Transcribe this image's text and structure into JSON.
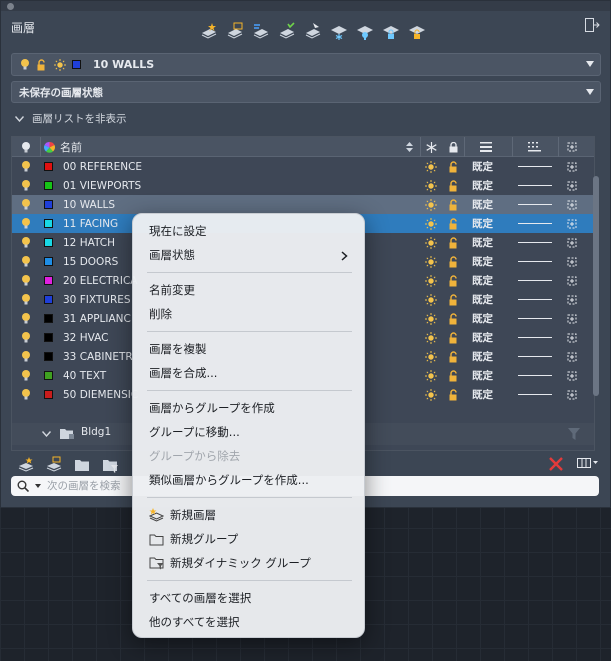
{
  "panel": {
    "title": "画層",
    "current_layer": {
      "name": "10 WALLS",
      "color": "#1f3fd8"
    },
    "layer_state": "未保存の画層状態",
    "collapse_label": "画層リストを非表示",
    "search_placeholder": "次の画層を検索"
  },
  "toolbar_icons": [
    "new-layer-icon",
    "new-vp-frozen-layer-icon",
    "delete-layer-icon",
    "set-current-icon",
    "layer-match-icon",
    "freeze-icon",
    "isolate-icon",
    "lock-icon",
    "unlock-icon"
  ],
  "table": {
    "headers": {
      "name": "名前"
    },
    "rows": [
      {
        "name": "00 REFERENCE",
        "color": "#e01010",
        "linetype": "既定"
      },
      {
        "name": "01 VIEWPORTS",
        "color": "#16c316",
        "linetype": "既定"
      },
      {
        "name": "10 WALLS",
        "color": "#1f3fd8",
        "linetype": "既定",
        "state": "current"
      },
      {
        "name": "11 FACING",
        "color": "#19d8e6",
        "linetype": "既定",
        "state": "selected"
      },
      {
        "name": "12 HATCH",
        "color": "#19d8e6",
        "linetype": "既定"
      },
      {
        "name": "15 DOORS",
        "color": "#1f8ee6",
        "linetype": "既定"
      },
      {
        "name": "20 ELECTRICA",
        "color": "#e020e0",
        "linetype": "既定"
      },
      {
        "name": "30 FIXTURES",
        "color": "#1f3fd8",
        "linetype": "既定"
      },
      {
        "name": "31 APPLIANC",
        "color": "#000000",
        "linetype": "既定"
      },
      {
        "name": "32 HVAC",
        "color": "#000000",
        "linetype": "既定"
      },
      {
        "name": "33 CABINETR",
        "color": "#000000",
        "linetype": "既定"
      },
      {
        "name": "40 TEXT",
        "color": "#3fa020",
        "linetype": "既定"
      },
      {
        "name": "50 DIEMENSIC",
        "color": "#c81c1c",
        "linetype": "既定"
      }
    ],
    "group": {
      "name": "Bldg1"
    }
  },
  "context_menu": {
    "set_current": "現在に設定",
    "layer_states": "画層状態",
    "rename": "名前変更",
    "delete": "削除",
    "duplicate": "画層を複製",
    "merge": "画層を合成...",
    "group_from_layers": "画層からグループを作成",
    "move_to_group": "グループに移動...",
    "remove_from_group": "グループから除去",
    "group_from_similar": "類似画層からグループを作成...",
    "new_layer": "新規画層",
    "new_group": "新規グループ",
    "new_dynamic_group": "新規ダイナミック グループ",
    "select_all": "すべての画層を選択",
    "select_all_others": "他のすべてを選択"
  }
}
